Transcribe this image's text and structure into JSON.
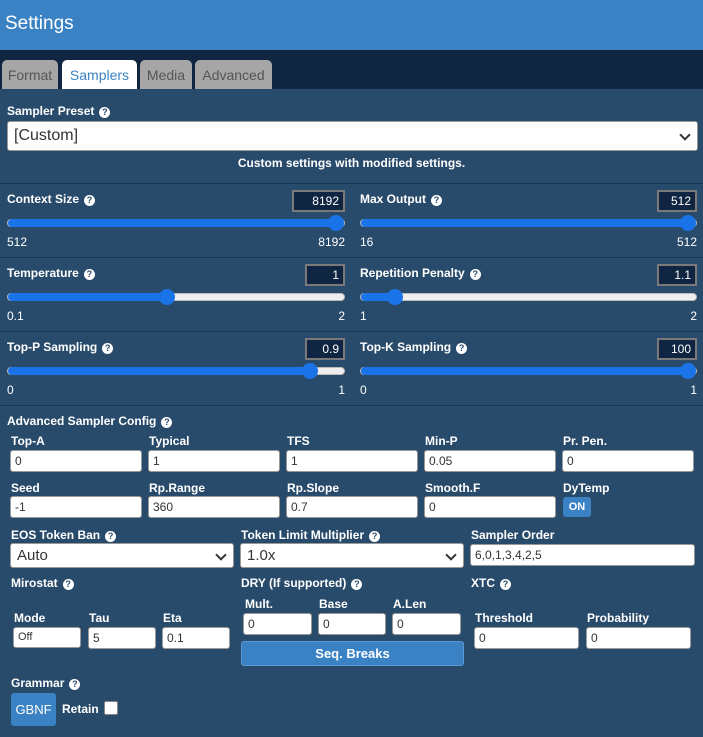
{
  "header": {
    "title": "Settings"
  },
  "tabs": [
    {
      "label": "Format"
    },
    {
      "label": "Samplers"
    },
    {
      "label": "Media"
    },
    {
      "label": "Advanced"
    }
  ],
  "help_glyph": "?",
  "preset": {
    "label": "Sampler Preset",
    "value": "[Custom]",
    "description": "Custom settings with modified settings."
  },
  "sliders": {
    "context_size": {
      "label": "Context Size",
      "value": "8192",
      "min": "512",
      "max": "8192",
      "fraction": 1.0
    },
    "max_output": {
      "label": "Max Output",
      "value": "512",
      "min": "16",
      "max": "512",
      "fraction": 1.0
    },
    "temperature": {
      "label": "Temperature",
      "value": "1",
      "min": "0.1",
      "max": "2",
      "fraction": 0.474
    },
    "rep_penalty": {
      "label": "Repetition Penalty",
      "value": "1.1",
      "min": "1",
      "max": "2",
      "fraction": 0.1
    },
    "top_p": {
      "label": "Top-P Sampling",
      "value": "0.9",
      "min": "0",
      "max": "1",
      "fraction": 0.9
    },
    "top_k": {
      "label": "Top-K Sampling",
      "value": "100",
      "min": "0",
      "max": "1",
      "fraction": 1.0
    }
  },
  "advanced": {
    "label": "Advanced Sampler Config",
    "fields": [
      {
        "label": "Top-A",
        "value": "0"
      },
      {
        "label": "Typical",
        "value": "1"
      },
      {
        "label": "TFS",
        "value": "1"
      },
      {
        "label": "Min-P",
        "value": "0.05"
      },
      {
        "label": "Pr. Pen.",
        "value": "0"
      },
      {
        "label": "Seed",
        "value": "-1"
      },
      {
        "label": "Rp.Range",
        "value": "360"
      },
      {
        "label": "Rp.Slope",
        "value": "0.7"
      },
      {
        "label": "Smooth.F",
        "value": "0"
      }
    ],
    "dytemp": {
      "label": "DyTemp",
      "button": "ON"
    }
  },
  "eos": {
    "label": "EOS Token Ban",
    "value": "Auto"
  },
  "token_limit": {
    "label": "Token Limit Multiplier",
    "value": "1.0x"
  },
  "sampler_order": {
    "label": "Sampler Order",
    "value": "6,0,1,3,4,2,5"
  },
  "mirostat": {
    "label": "Mirostat",
    "mode": {
      "label": "Mode",
      "value": "Off"
    },
    "tau": {
      "label": "Tau",
      "value": "5"
    },
    "eta": {
      "label": "Eta",
      "value": "0.1"
    }
  },
  "dry": {
    "label": "DRY (If supported)",
    "mult": {
      "label": "Mult.",
      "value": "0"
    },
    "base": {
      "label": "Base",
      "value": "0"
    },
    "alen": {
      "label": "A.Len",
      "value": "0"
    },
    "seq_breaks": "Seq. Breaks"
  },
  "xtc": {
    "label": "XTC",
    "threshold": {
      "label": "Threshold",
      "value": "0"
    },
    "probability": {
      "label": "Probability",
      "value": "0"
    }
  },
  "grammar": {
    "label": "Grammar",
    "button": "GBNF",
    "retain_label": "Retain",
    "retain_checked": false
  }
}
